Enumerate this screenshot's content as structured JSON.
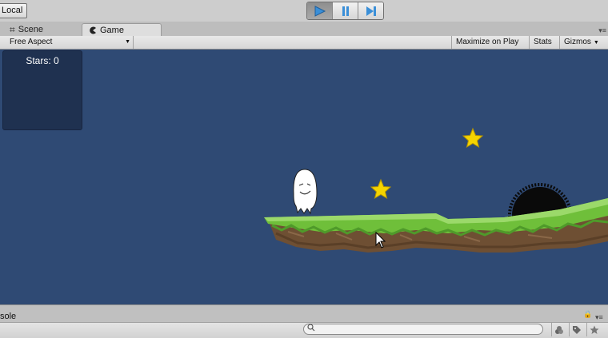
{
  "toolbar": {
    "layers_label": "Local",
    "play_icon": "play-icon",
    "pause_icon": "pause-icon",
    "step_icon": "step-icon"
  },
  "tabs": [
    {
      "label": "Scene",
      "icon": "scene-grid-icon"
    },
    {
      "label": "Game",
      "icon": "game-pacman-icon"
    }
  ],
  "game_toolbar": {
    "aspect": "Free Aspect",
    "maximize": "Maximize on Play",
    "stats": "Stats",
    "gizmos": "Gizmos"
  },
  "game_view": {
    "background": "#2f4a74",
    "hud": {
      "stars_text": "Stars: 0"
    },
    "sprites": [
      "ghost-character",
      "star",
      "star",
      "spiky-black-enemy",
      "grass-platform"
    ]
  },
  "console": {
    "label": "sole",
    "search_placeholder": ""
  }
}
